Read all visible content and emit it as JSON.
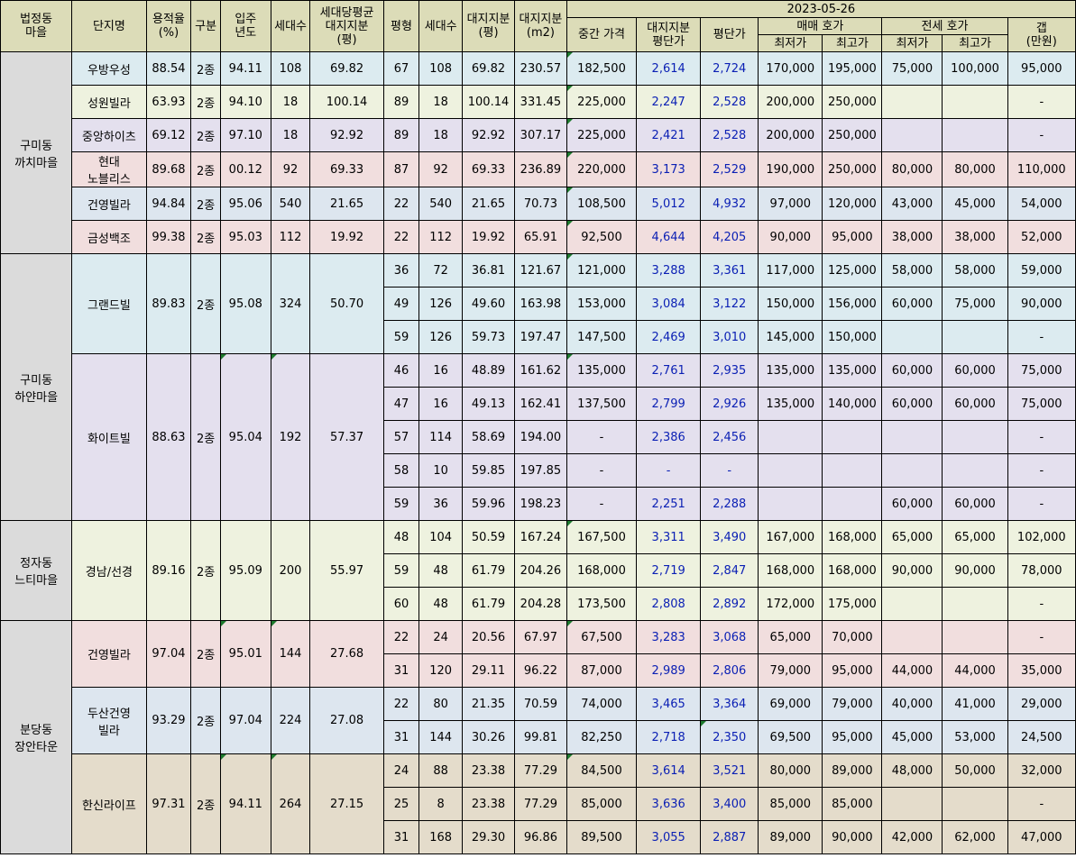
{
  "date": "2023-05-26",
  "headers": {
    "region": "법정동\n마을",
    "complex": "단지명",
    "far": "용적율\n(%)",
    "zone": "구분",
    "built": "입주\n년도",
    "units": "세대수",
    "avg_land_share": "세대당평균\n대지지분\n(평)",
    "pyeong": "평형",
    "type_units": "세대수",
    "land_share": "대지지분\n(평)",
    "land_share_m2": "대지지분\n(m2)",
    "mid_price": "중간 가격",
    "land_price": "대지지분\n평단가",
    "pyeong_price": "평단가",
    "sale": "매매 호가",
    "jeonse": "전세 호가",
    "min": "최저가",
    "max": "최고가",
    "gap": "갭\n(만원)"
  },
  "regions": [
    {
      "name": "구미동\n까치마을",
      "span": 6
    },
    {
      "name": "구미동\n하얀마을",
      "span": 8
    },
    {
      "name": "정자동\n느티마을",
      "span": 3
    },
    {
      "name": "분당동\n장안타운",
      "span": 7
    }
  ],
  "complexes": [
    {
      "name": "우방우성",
      "far": "88.54",
      "zone": "2종",
      "built": "94.11",
      "units": "108",
      "avg": "69.82",
      "span": 1,
      "color": "blue"
    },
    {
      "name": "성원빌라",
      "far": "63.93",
      "zone": "2종",
      "built": "94.10",
      "units": "18",
      "avg": "100.14",
      "span": 1,
      "color": "green"
    },
    {
      "name": "중앙하이츠",
      "far": "69.12",
      "zone": "2종",
      "built": "97.10",
      "units": "18",
      "avg": "92.92",
      "span": 1,
      "color": "purple"
    },
    {
      "name": "현대\n노블리스",
      "far": "89.68",
      "zone": "2종",
      "built": "00.12",
      "units": "92",
      "avg": "69.33",
      "span": 1,
      "color": "pink"
    },
    {
      "name": "건영빌라",
      "far": "94.84",
      "zone": "2종",
      "built": "95.06",
      "units": "540",
      "avg": "21.65",
      "span": 1,
      "color": "lblue"
    },
    {
      "name": "금성백조",
      "far": "99.38",
      "zone": "2종",
      "built": "95.03",
      "units": "112",
      "avg": "19.92",
      "span": 1,
      "color": "pink"
    },
    {
      "name": "그랜드빌",
      "far": "89.83",
      "zone": "2종",
      "built": "95.08",
      "units": "324",
      "avg": "50.70",
      "span": 3,
      "color": "blue"
    },
    {
      "name": "화이트빌",
      "far": "88.63",
      "zone": "2종",
      "built": "95.04",
      "units": "192",
      "avg": "57.37",
      "span": 5,
      "color": "purple"
    },
    {
      "name": "경남/선경",
      "far": "89.16",
      "zone": "2종",
      "built": "95.09",
      "units": "200",
      "avg": "55.97",
      "span": 3,
      "color": "green"
    },
    {
      "name": "건영빌라",
      "far": "97.04",
      "zone": "2종",
      "built": "95.01",
      "units": "144",
      "avg": "27.68",
      "span": 2,
      "color": "pink"
    },
    {
      "name": "두산건영\n빌라",
      "far": "93.29",
      "zone": "2종",
      "built": "97.04",
      "units": "224",
      "avg": "27.08",
      "span": 2,
      "color": "lblue"
    },
    {
      "name": "한신라이프",
      "far": "97.31",
      "zone": "2종",
      "built": "94.11",
      "units": "264",
      "avg": "27.15",
      "span": 3,
      "color": "tan"
    }
  ],
  "rows": [
    {
      "pyeong": "67",
      "units": "108",
      "land": "69.82",
      "m2": "230.57",
      "mid": "182,500",
      "lp": "2,614",
      "pp": "2,724",
      "smin": "170,000",
      "smax": "195,000",
      "jmin": "75,000",
      "jmax": "100,000",
      "gap": "95,000"
    },
    {
      "pyeong": "89",
      "units": "18",
      "land": "100.14",
      "m2": "331.45",
      "mid": "225,000",
      "lp": "2,247",
      "pp": "2,528",
      "smin": "200,000",
      "smax": "250,000",
      "jmin": "",
      "jmax": "",
      "gap": "-"
    },
    {
      "pyeong": "89",
      "units": "18",
      "land": "92.92",
      "m2": "307.17",
      "mid": "225,000",
      "lp": "2,421",
      "pp": "2,528",
      "smin": "200,000",
      "smax": "250,000",
      "jmin": "",
      "jmax": "",
      "gap": "-"
    },
    {
      "pyeong": "87",
      "units": "92",
      "land": "69.33",
      "m2": "236.89",
      "mid": "220,000",
      "lp": "3,173",
      "pp": "2,529",
      "smin": "190,000",
      "smax": "250,000",
      "jmin": "80,000",
      "jmax": "80,000",
      "gap": "110,000"
    },
    {
      "pyeong": "22",
      "units": "540",
      "land": "21.65",
      "m2": "70.73",
      "mid": "108,500",
      "lp": "5,012",
      "pp": "4,932",
      "smin": "97,000",
      "smax": "120,000",
      "jmin": "43,000",
      "jmax": "45,000",
      "gap": "54,000"
    },
    {
      "pyeong": "22",
      "units": "112",
      "land": "19.92",
      "m2": "65.91",
      "mid": "92,500",
      "lp": "4,644",
      "pp": "4,205",
      "smin": "90,000",
      "smax": "95,000",
      "jmin": "38,000",
      "jmax": "38,000",
      "gap": "52,000"
    },
    {
      "pyeong": "36",
      "units": "72",
      "land": "36.81",
      "m2": "121.67",
      "mid": "121,000",
      "lp": "3,288",
      "pp": "3,361",
      "smin": "117,000",
      "smax": "125,000",
      "jmin": "58,000",
      "jmax": "58,000",
      "gap": "59,000"
    },
    {
      "pyeong": "49",
      "units": "126",
      "land": "49.60",
      "m2": "163.98",
      "mid": "153,000",
      "lp": "3,084",
      "pp": "3,122",
      "smin": "150,000",
      "smax": "156,000",
      "jmin": "60,000",
      "jmax": "75,000",
      "gap": "90,000"
    },
    {
      "pyeong": "59",
      "units": "126",
      "land": "59.73",
      "m2": "197.47",
      "mid": "147,500",
      "lp": "2,469",
      "pp": "3,010",
      "smin": "145,000",
      "smax": "150,000",
      "jmin": "",
      "jmax": "",
      "gap": "-"
    },
    {
      "pyeong": "46",
      "units": "16",
      "land": "48.89",
      "m2": "161.62",
      "mid": "135,000",
      "lp": "2,761",
      "pp": "2,935",
      "smin": "135,000",
      "smax": "135,000",
      "jmin": "60,000",
      "jmax": "60,000",
      "gap": "75,000"
    },
    {
      "pyeong": "47",
      "units": "16",
      "land": "49.13",
      "m2": "162.41",
      "mid": "137,500",
      "lp": "2,799",
      "pp": "2,926",
      "smin": "135,000",
      "smax": "140,000",
      "jmin": "60,000",
      "jmax": "60,000",
      "gap": "75,000"
    },
    {
      "pyeong": "57",
      "units": "114",
      "land": "58.69",
      "m2": "194.00",
      "mid": "-",
      "lp": "2,386",
      "pp": "2,456",
      "smin": "",
      "smax": "",
      "jmin": "",
      "jmax": "",
      "gap": "-"
    },
    {
      "pyeong": "58",
      "units": "10",
      "land": "59.85",
      "m2": "197.85",
      "mid": "-",
      "lp": "-",
      "pp": "-",
      "smin": "",
      "smax": "",
      "jmin": "",
      "jmax": "",
      "gap": "-"
    },
    {
      "pyeong": "59",
      "units": "36",
      "land": "59.96",
      "m2": "198.23",
      "mid": "-",
      "lp": "2,251",
      "pp": "2,288",
      "smin": "",
      "smax": "",
      "jmin": "60,000",
      "jmax": "60,000",
      "gap": "-"
    },
    {
      "pyeong": "48",
      "units": "104",
      "land": "50.59",
      "m2": "167.24",
      "mid": "167,500",
      "lp": "3,311",
      "pp": "3,490",
      "smin": "167,000",
      "smax": "168,000",
      "jmin": "65,000",
      "jmax": "65,000",
      "gap": "102,000"
    },
    {
      "pyeong": "59",
      "units": "48",
      "land": "61.79",
      "m2": "204.26",
      "mid": "168,000",
      "lp": "2,719",
      "pp": "2,847",
      "smin": "168,000",
      "smax": "168,000",
      "jmin": "90,000",
      "jmax": "90,000",
      "gap": "78,000"
    },
    {
      "pyeong": "60",
      "units": "48",
      "land": "61.79",
      "m2": "204.28",
      "mid": "173,500",
      "lp": "2,808",
      "pp": "2,892",
      "smin": "172,000",
      "smax": "175,000",
      "jmin": "",
      "jmax": "",
      "gap": "-"
    },
    {
      "pyeong": "22",
      "units": "24",
      "land": "20.56",
      "m2": "67.97",
      "mid": "67,500",
      "lp": "3,283",
      "pp": "3,068",
      "smin": "65,000",
      "smax": "70,000",
      "jmin": "",
      "jmax": "",
      "gap": "-"
    },
    {
      "pyeong": "31",
      "units": "120",
      "land": "29.11",
      "m2": "96.22",
      "mid": "87,000",
      "lp": "2,989",
      "pp": "2,806",
      "smin": "79,000",
      "smax": "95,000",
      "jmin": "44,000",
      "jmax": "44,000",
      "gap": "35,000"
    },
    {
      "pyeong": "22",
      "units": "80",
      "land": "21.35",
      "m2": "70.59",
      "mid": "74,000",
      "lp": "3,465",
      "pp": "3,364",
      "smin": "69,000",
      "smax": "79,000",
      "jmin": "40,000",
      "jmax": "41,000",
      "gap": "29,000"
    },
    {
      "pyeong": "31",
      "units": "144",
      "land": "30.26",
      "m2": "99.81",
      "mid": "82,250",
      "lp": "2,718",
      "pp": "2,350",
      "smin": "69,500",
      "smax": "95,000",
      "jmin": "45,000",
      "jmax": "53,000",
      "gap": "24,500"
    },
    {
      "pyeong": "24",
      "units": "88",
      "land": "23.38",
      "m2": "77.29",
      "mid": "84,500",
      "lp": "3,614",
      "pp": "3,521",
      "smin": "80,000",
      "smax": "89,000",
      "jmin": "48,000",
      "jmax": "50,000",
      "gap": "32,000"
    },
    {
      "pyeong": "25",
      "units": "8",
      "land": "23.38",
      "m2": "77.29",
      "mid": "85,000",
      "lp": "3,636",
      "pp": "3,400",
      "smin": "85,000",
      "smax": "85,000",
      "jmin": "",
      "jmax": "",
      "gap": "-"
    },
    {
      "pyeong": "31",
      "units": "168",
      "land": "29.30",
      "m2": "96.86",
      "mid": "89,500",
      "lp": "3,055",
      "pp": "2,887",
      "smin": "89,000",
      "smax": "90,000",
      "jmin": "42,000",
      "jmax": "62,000",
      "gap": "47,000"
    }
  ]
}
